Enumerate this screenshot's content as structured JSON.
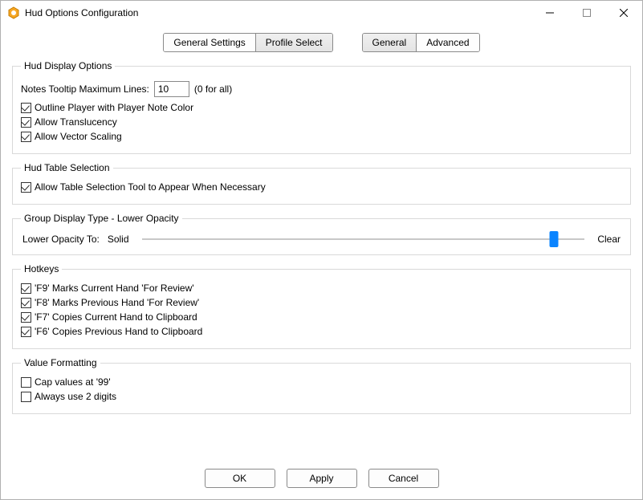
{
  "window": {
    "title": "Hud Options Configuration"
  },
  "tabs": {
    "left": [
      "General Settings",
      "Profile Select"
    ],
    "left_active": 1,
    "right": [
      "General",
      "Advanced"
    ],
    "right_active": 0
  },
  "groups": {
    "hud_display": {
      "legend": "Hud Display Options",
      "notes_label": "Notes Tooltip Maximum Lines:",
      "notes_value": "10",
      "notes_hint": "(0 for all)",
      "outline_player": {
        "label": "Outline Player with Player Note Color",
        "checked": true
      },
      "allow_translucency": {
        "label": "Allow Translucency",
        "checked": true
      },
      "allow_vector_scaling": {
        "label": "Allow Vector Scaling",
        "checked": true
      }
    },
    "hud_table_selection": {
      "legend": "Hud Table Selection",
      "allow_tool": {
        "label": "Allow Table Selection Tool to Appear When Necessary",
        "checked": true
      }
    },
    "group_display_type": {
      "legend": "Group Display Type - Lower Opacity",
      "slider_label": "Lower Opacity To:",
      "slider_left": "Solid",
      "slider_right": "Clear",
      "slider_pct": 93
    },
    "hotkeys": {
      "legend": "Hotkeys",
      "items": [
        {
          "label": "'F9' Marks Current Hand 'For Review'",
          "checked": true
        },
        {
          "label": "'F8' Marks Previous Hand 'For Review'",
          "checked": true
        },
        {
          "label": "'F7' Copies Current Hand to Clipboard",
          "checked": true
        },
        {
          "label": "'F6' Copies Previous Hand to Clipboard",
          "checked": true
        }
      ]
    },
    "value_formatting": {
      "legend": "Value Formatting",
      "cap_values": {
        "label": "Cap values at '99'",
        "checked": false
      },
      "always_two_digits": {
        "label": "Always use 2 digits",
        "checked": false
      }
    }
  },
  "footer": {
    "ok": "OK",
    "apply": "Apply",
    "cancel": "Cancel"
  }
}
